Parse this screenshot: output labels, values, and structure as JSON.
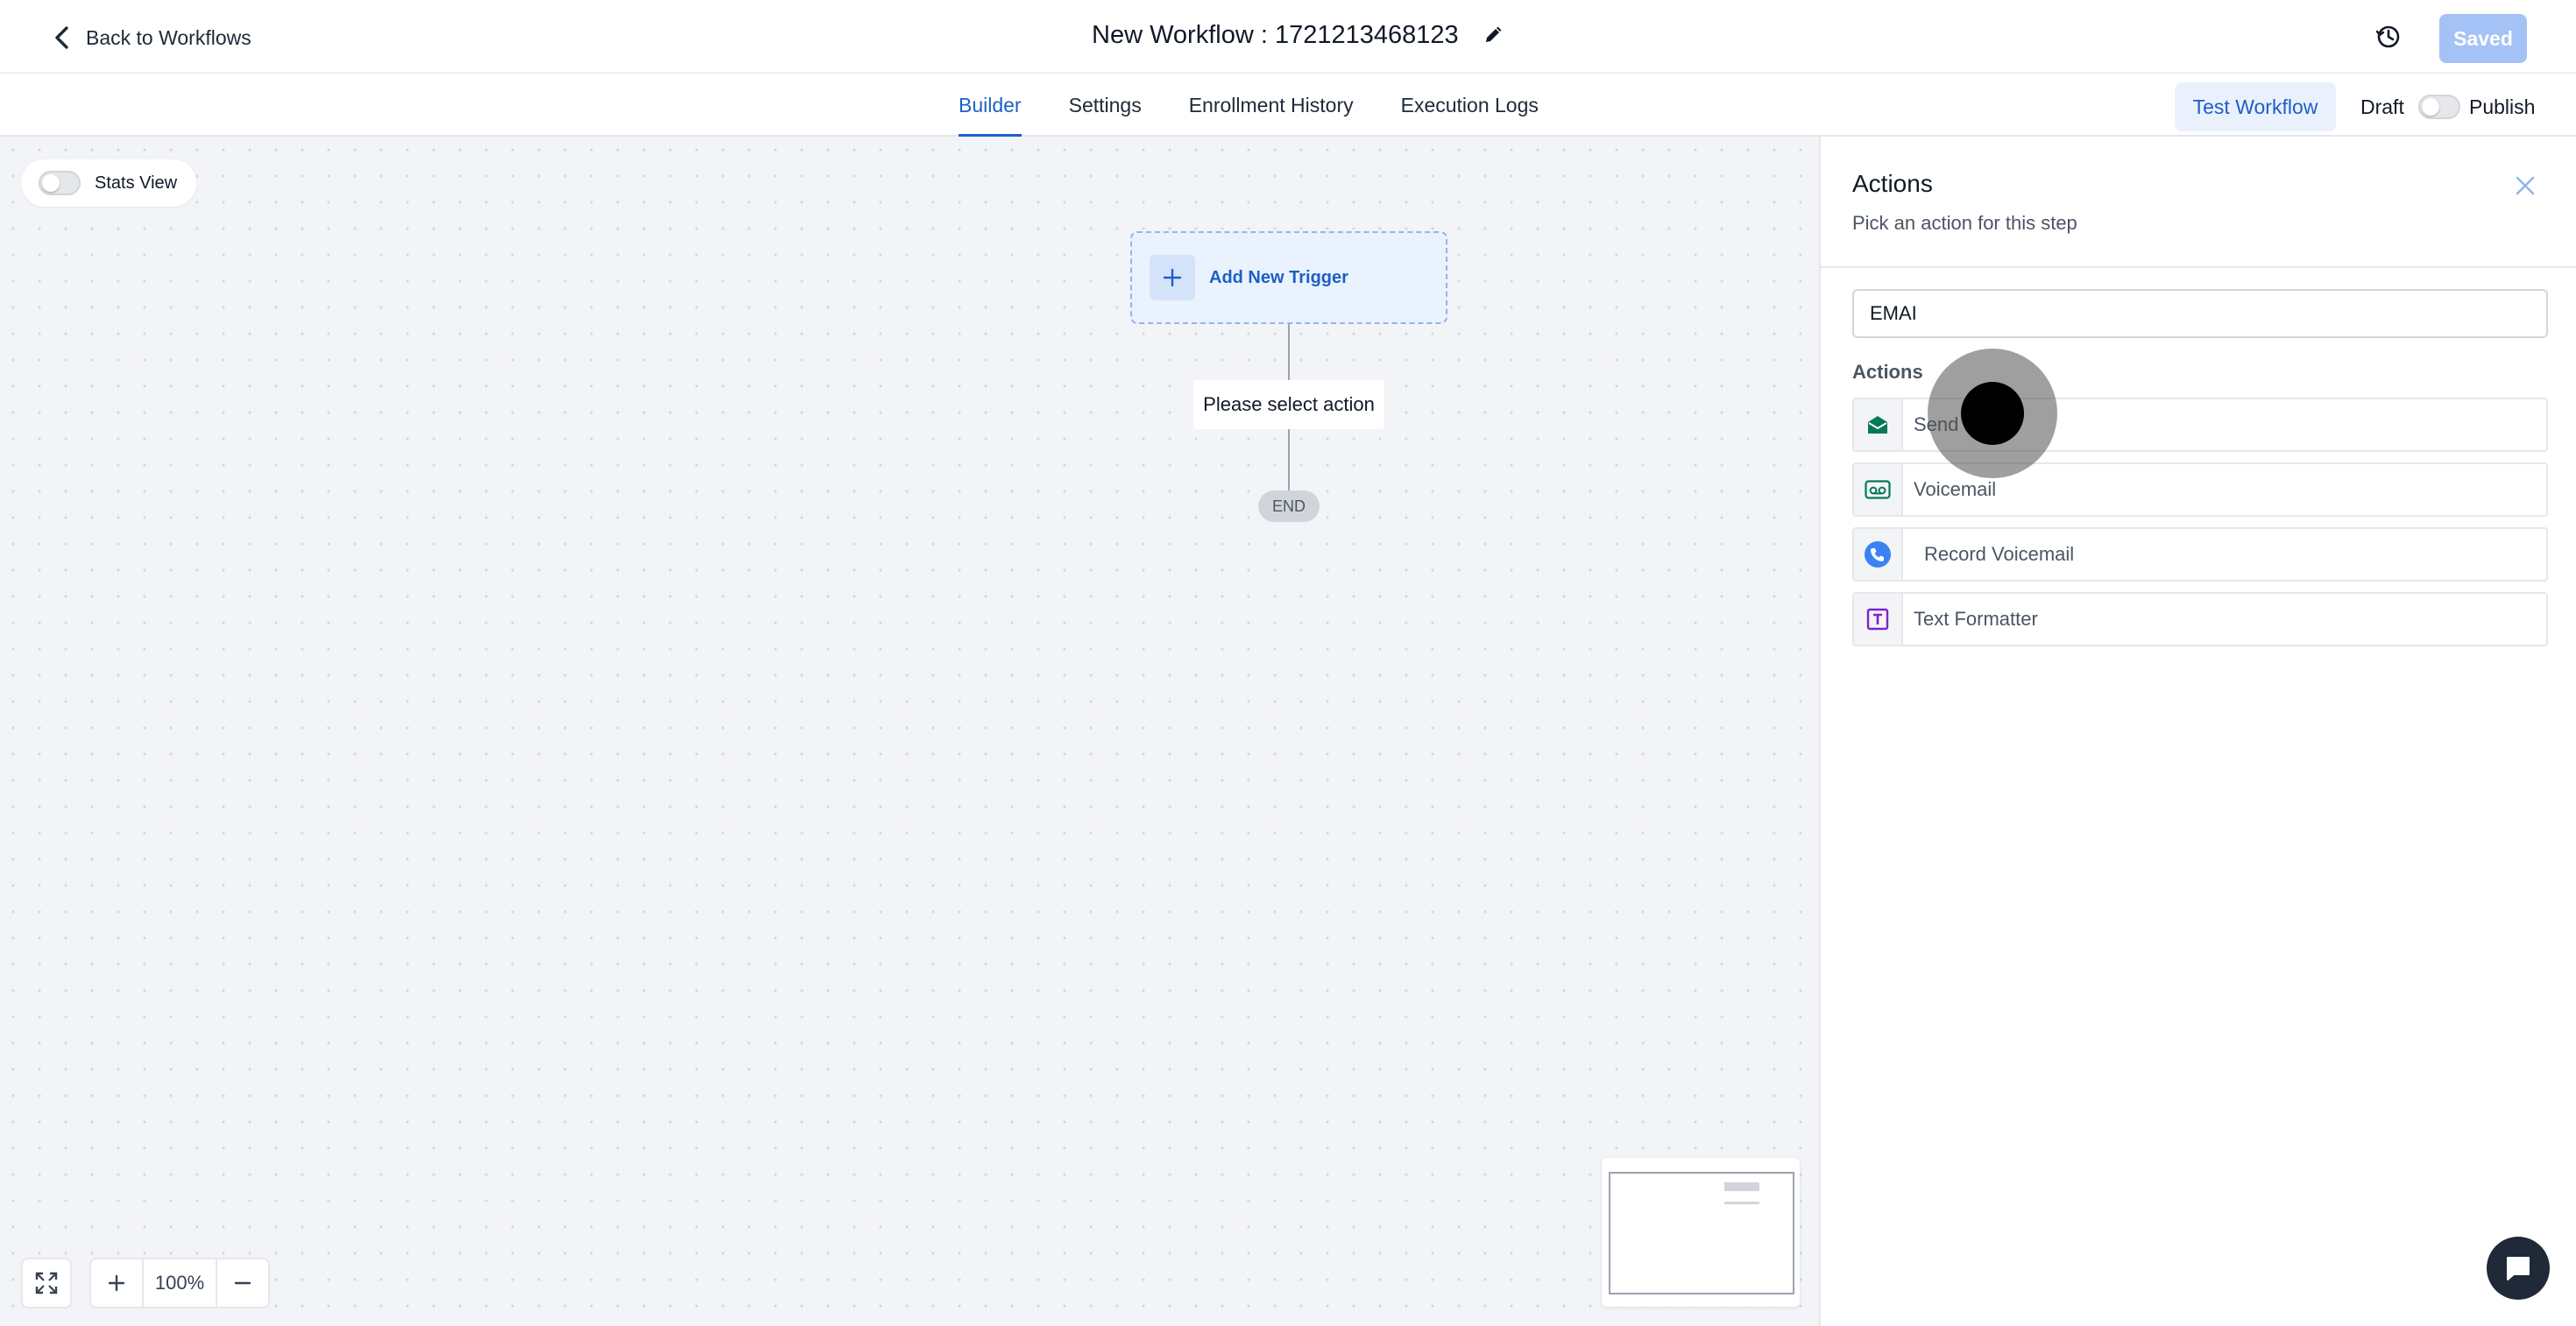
{
  "header": {
    "back_label": "Back to Workflows",
    "workflow_title": "New Workflow : 1721213468123",
    "saved_label": "Saved"
  },
  "tabs": [
    {
      "label": "Builder",
      "active": true
    },
    {
      "label": "Settings",
      "active": false
    },
    {
      "label": "Enrollment History",
      "active": false
    },
    {
      "label": "Execution Logs",
      "active": false
    }
  ],
  "toolbar": {
    "test_label": "Test Workflow",
    "draft_label": "Draft",
    "publish_label": "Publish",
    "publish_on": false
  },
  "canvas": {
    "stats_view_label": "Stats View",
    "stats_view_on": false,
    "trigger_label": "Add New Trigger",
    "select_action_label": "Please select action",
    "end_label": "END",
    "zoom_level": "100%"
  },
  "panel": {
    "title": "Actions",
    "subtitle": "Pick an action for this step",
    "search_value": "EMAI",
    "section_label": "Actions",
    "items": [
      {
        "label": "Send Email",
        "icon": "mail-open-icon",
        "color": "#047857"
      },
      {
        "label": "Voicemail",
        "icon": "voicemail-icon",
        "color": "#047857"
      },
      {
        "label": "Record Voicemail",
        "icon": "phone-record-icon",
        "color": "#2563eb"
      },
      {
        "label": "Text Formatter",
        "icon": "text-format-icon",
        "color": "#7e22ce"
      }
    ]
  },
  "colors": {
    "accent": "#1d5fc7",
    "saved_button": "#a5c2f7",
    "canvas_bg": "#f3f4f7"
  }
}
